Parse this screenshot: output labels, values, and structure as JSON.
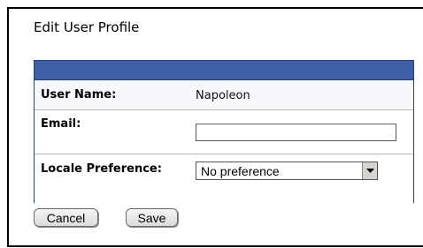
{
  "form": {
    "title": "Edit User Profile"
  },
  "fields": {
    "user_name_label": "User Name:",
    "user_name_value": "Napoleon",
    "email_label": "Email:",
    "email_value": "",
    "locale_label": "Locale Preference:",
    "locale_selected": "No preference"
  },
  "buttons": {
    "cancel_label": "Cancel",
    "save_label": "Save"
  },
  "colors": {
    "header_bar": "#3e5fa6",
    "panel_border": "#2b4070"
  },
  "icons": {
    "select_arrow": "chevron-down-icon"
  }
}
